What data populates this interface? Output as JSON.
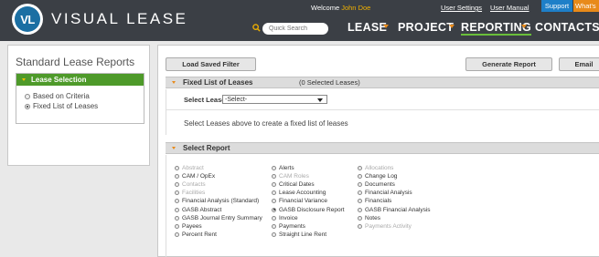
{
  "header": {
    "logo_mark": "VL",
    "logo_text": "VISUAL LEASE",
    "welcome_prefix": "Welcome",
    "user_name": "John Doe",
    "links": [
      "User Settings",
      "User Manual"
    ],
    "support_label": "Support",
    "whats_label": "What's",
    "search_placeholder": "Quick Search",
    "nav": [
      {
        "label": "LEASE",
        "active": false
      },
      {
        "label": "PROJECT",
        "active": false
      },
      {
        "label": "REPORTING",
        "active": true
      },
      {
        "label": "CONTACTS",
        "active": false
      }
    ],
    "colors": {
      "header_bg": "#3b3f45",
      "accent_green": "#4e9a2a",
      "accent_orange": "#e88a1a",
      "support_blue": "#1e7fc8"
    }
  },
  "left": {
    "title": "Standard Lease Reports",
    "section_label": "Lease Selection",
    "options": [
      {
        "label": "Based on Criteria",
        "checked": false
      },
      {
        "label": "Fixed List of Leases",
        "checked": true
      }
    ]
  },
  "main": {
    "load_filter_label": "Load Saved Filter",
    "generate_label": "Generate Report",
    "email_label": "Email",
    "fixed_list": {
      "title": "Fixed List of Leases",
      "count": "(0 Selected Leases)",
      "select_label": "Select Lease",
      "select_value": "-Select-",
      "hint": "Select Leases above to create a fixed list of leases"
    },
    "select_report": {
      "title": "Select Report",
      "columns": [
        [
          {
            "label": "Abstract",
            "disabled": true,
            "checked": false
          },
          {
            "label": "CAM / OpEx",
            "disabled": false,
            "checked": false
          },
          {
            "label": "Contacts",
            "disabled": true,
            "checked": false
          },
          {
            "label": "Facilities",
            "disabled": true,
            "checked": false
          },
          {
            "label": "Financial Analysis (Standard)",
            "disabled": false,
            "checked": false
          },
          {
            "label": "GASB Abstract",
            "disabled": false,
            "checked": false
          },
          {
            "label": "GASB Journal Entry Summary",
            "disabled": false,
            "checked": false
          },
          {
            "label": "Payees",
            "disabled": false,
            "checked": false
          },
          {
            "label": "Percent Rent",
            "disabled": false,
            "checked": false
          }
        ],
        [
          {
            "label": "Alerts",
            "disabled": false,
            "checked": false
          },
          {
            "label": "CAM Roles",
            "disabled": true,
            "checked": false
          },
          {
            "label": "Critical Dates",
            "disabled": false,
            "checked": false
          },
          {
            "label": "Lease Accounting",
            "disabled": false,
            "checked": false
          },
          {
            "label": "Financial Variance",
            "disabled": false,
            "checked": false
          },
          {
            "label": "GASB Disclosure Report",
            "disabled": false,
            "checked": true
          },
          {
            "label": "Invoice",
            "disabled": false,
            "checked": false
          },
          {
            "label": "Payments",
            "disabled": false,
            "checked": false
          },
          {
            "label": "Straight Line Rent",
            "disabled": false,
            "checked": false
          }
        ],
        [
          {
            "label": "Allocations",
            "disabled": true,
            "checked": false
          },
          {
            "label": "Change Log",
            "disabled": false,
            "checked": false
          },
          {
            "label": "Documents",
            "disabled": false,
            "checked": false
          },
          {
            "label": "Financial Analysis",
            "disabled": false,
            "checked": false
          },
          {
            "label": "Financials",
            "disabled": false,
            "checked": false
          },
          {
            "label": "GASB Financial Analysis",
            "disabled": false,
            "checked": false
          },
          {
            "label": "Notes",
            "disabled": false,
            "checked": false
          },
          {
            "label": "Payments Activity",
            "disabled": true,
            "checked": false
          }
        ]
      ]
    }
  }
}
